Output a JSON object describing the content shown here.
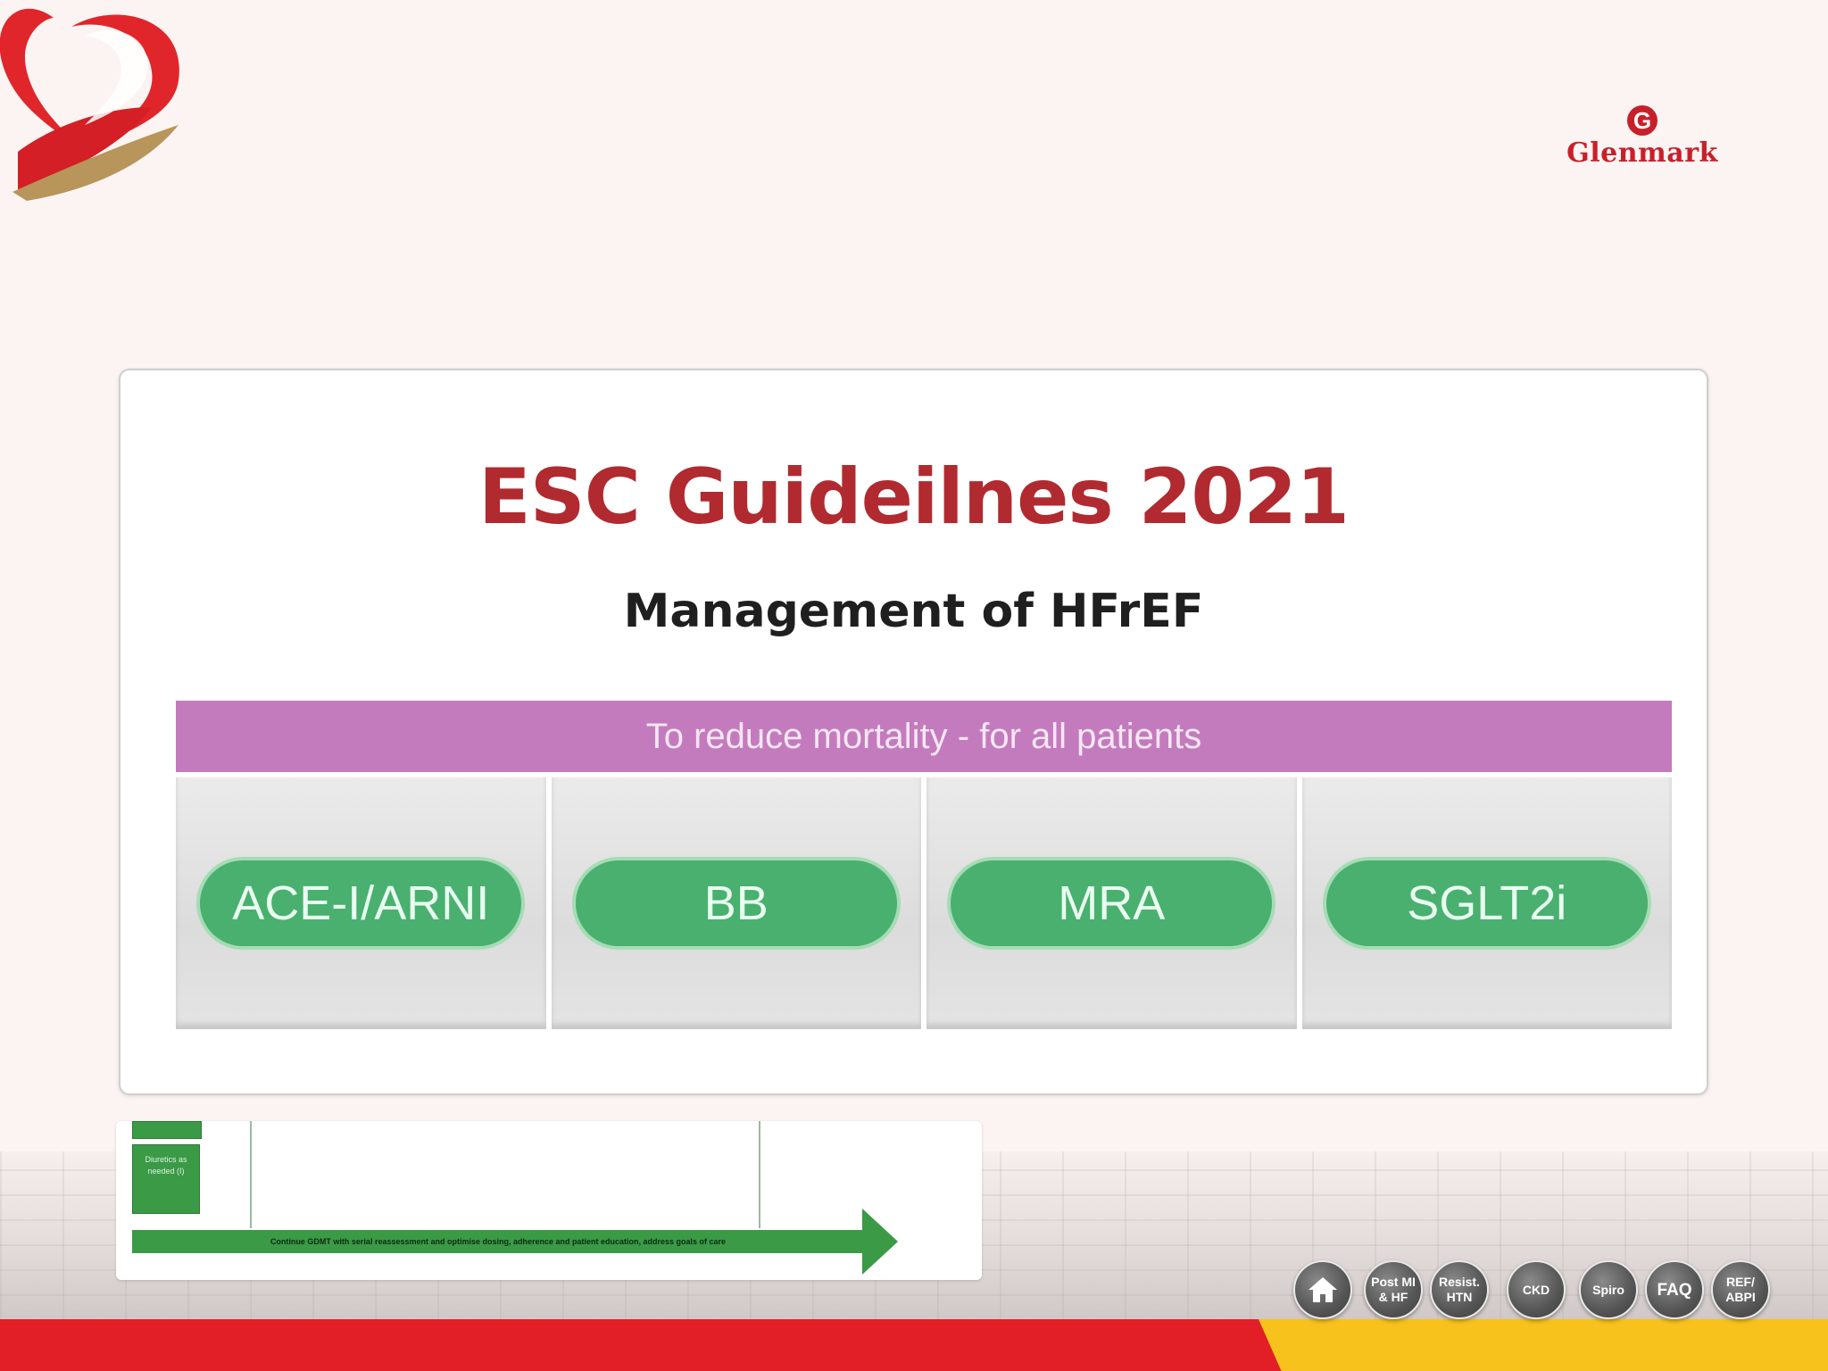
{
  "brand": {
    "name": "Glenmark",
    "mark": "G"
  },
  "slide": {
    "title": "ESC Guideilnes 2021",
    "subtitle": "Management of HFrEF",
    "band_label": "To reduce mortality - for all patients",
    "drugs": [
      "ACE-I/ARNI",
      "BB",
      "MRA",
      "SGLT2i"
    ]
  },
  "flowchart": {
    "box_label": "Diuretics as needed (I)",
    "arrow_label": "Continue GDMT with serial reassessment and optimise dosing, adherence and patient education, address goals of care"
  },
  "nav": {
    "home_icon": "home-icon",
    "buttons": [
      "Post MI & HF",
      "Resist. HTN",
      "CKD",
      "Spiro",
      "FAQ",
      "REF/ ABPI"
    ]
  },
  "colors": {
    "title_red": "#b02a2f",
    "band_purple": "#c47bbd",
    "pill_green": "#49b06f",
    "footer_red": "#e21e26",
    "footer_yellow": "#f7c21b"
  }
}
